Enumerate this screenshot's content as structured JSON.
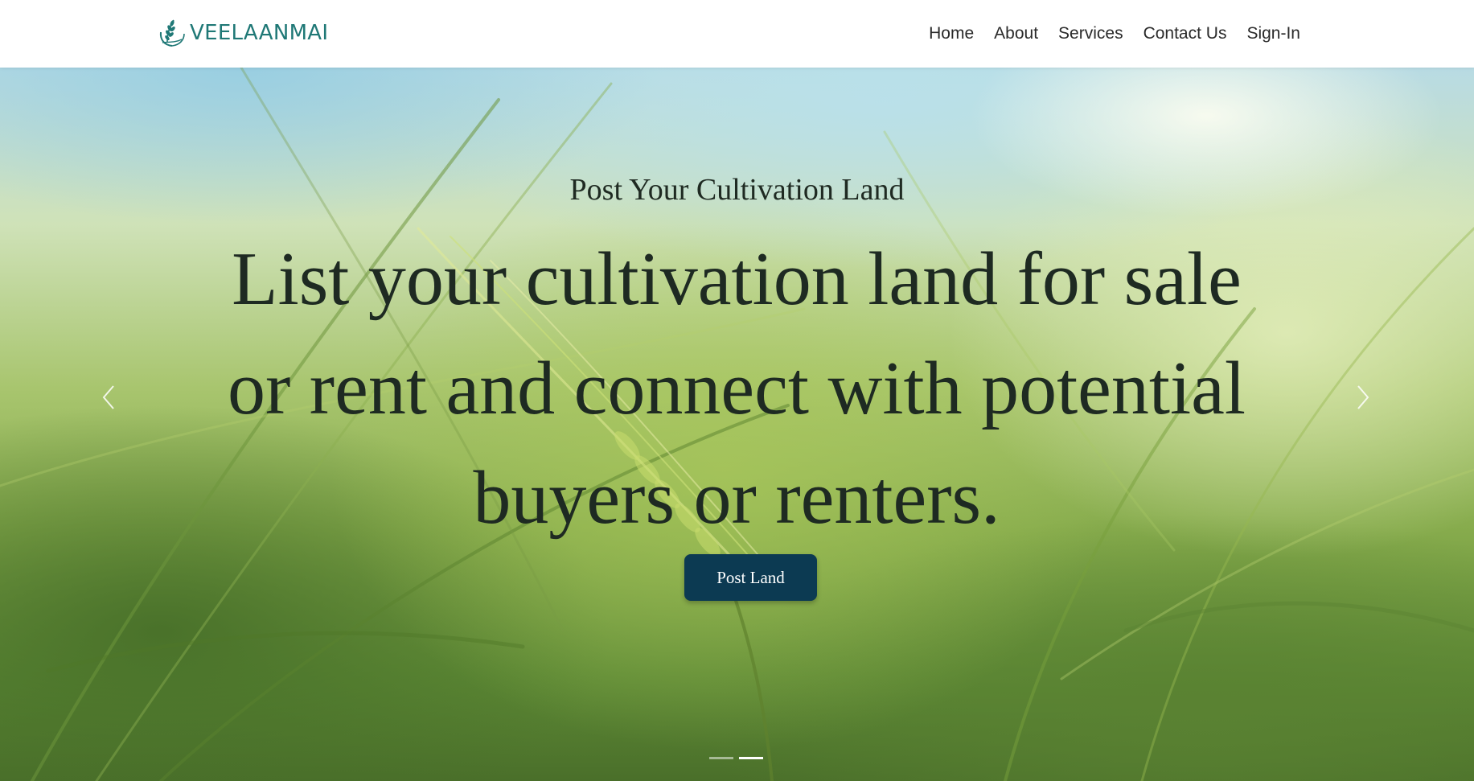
{
  "brand": {
    "name": "VEELAANMAI",
    "color": "#1f7876",
    "logo_icon": "leaf-wheat-icon"
  },
  "nav": {
    "items": [
      {
        "label": "Home"
      },
      {
        "label": "About"
      },
      {
        "label": "Services"
      },
      {
        "label": "Contact Us"
      },
      {
        "label": "Sign-In"
      }
    ]
  },
  "hero": {
    "subtitle": "Post Your Cultivation Land",
    "title": "List your cultivation land for sale or rent and connect with potential buyers or renters.",
    "button_label": "Post Land",
    "button_color": "#0c3a52",
    "background": "wheat-field-photo",
    "prev_icon": "chevron-left-icon",
    "next_icon": "chevron-right-icon",
    "slides_total": 2,
    "active_slide": 2
  }
}
